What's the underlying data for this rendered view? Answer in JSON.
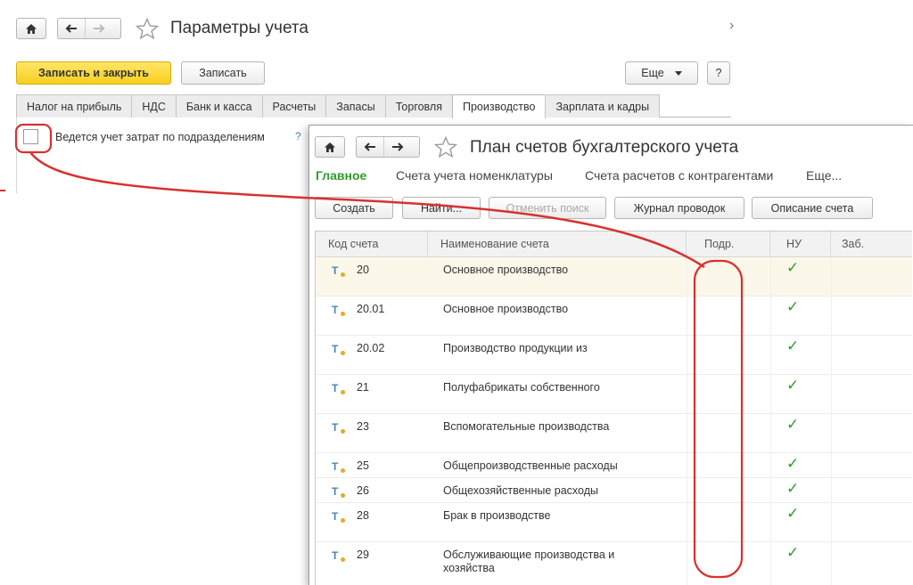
{
  "back_window": {
    "title": "Параметры учета",
    "buttons": {
      "save_close": "Записать и закрыть",
      "save": "Записать",
      "more": "Еще",
      "help": "?"
    },
    "tabs": [
      {
        "label": "Налог на прибыль",
        "active": false
      },
      {
        "label": "НДС",
        "active": false
      },
      {
        "label": "Банк и касса",
        "active": false
      },
      {
        "label": "Расчеты",
        "active": false
      },
      {
        "label": "Запасы",
        "active": false
      },
      {
        "label": "Торговля",
        "active": false
      },
      {
        "label": "Производство",
        "active": true
      },
      {
        "label": "Зарплата и кадры",
        "active": false
      }
    ],
    "option": {
      "label": "Ведется учет затрат по подразделениям",
      "checked": false,
      "help": "?"
    },
    "scroll_arrow": "›"
  },
  "front_window": {
    "title": "План счетов бухгалтерского учета",
    "subnav": [
      {
        "label": "Главное",
        "active": true
      },
      {
        "label": "Счета учета номенклатуры",
        "active": false
      },
      {
        "label": "Счета расчетов с контрагентами",
        "active": false
      },
      {
        "label": "Еще...",
        "active": false
      }
    ],
    "toolbar": {
      "create": "Создать",
      "find": "Найти...",
      "cancel_search": "Отменить поиск",
      "journal": "Журнал проводок",
      "description": "Описание счета"
    },
    "columns": {
      "code": "Код счета",
      "name": "Наименование счета",
      "subdiv": "Подр.",
      "nu": "НУ",
      "off": "Заб."
    },
    "rows": [
      {
        "code": "20",
        "name": "Основное производство",
        "nu": true,
        "selected": true
      },
      {
        "code": "20.01",
        "name": "Основное производство",
        "nu": true
      },
      {
        "code": "20.02",
        "name": "Производство продукции из",
        "nu": true
      },
      {
        "code": "21",
        "name": "Полуфабрикаты собственного",
        "nu": true
      },
      {
        "code": "23",
        "name": "Вспомогательные производства",
        "nu": true
      },
      {
        "code": "25",
        "name": "Общепроизводственные расходы",
        "nu": true
      },
      {
        "code": "26",
        "name": "Общехозяйственные расходы",
        "nu": true
      },
      {
        "code": "28",
        "name": "Брак в производстве",
        "nu": true
      },
      {
        "code": "29",
        "name": "Обслуживающие производства и хозяйства",
        "nu": true
      }
    ],
    "check_glyph": "✓",
    "account_icon_letter": "T"
  },
  "colors": {
    "annotation_red": "#d93030",
    "accent_green": "#2e9d2e",
    "primary_button": "#f7cf1f"
  }
}
